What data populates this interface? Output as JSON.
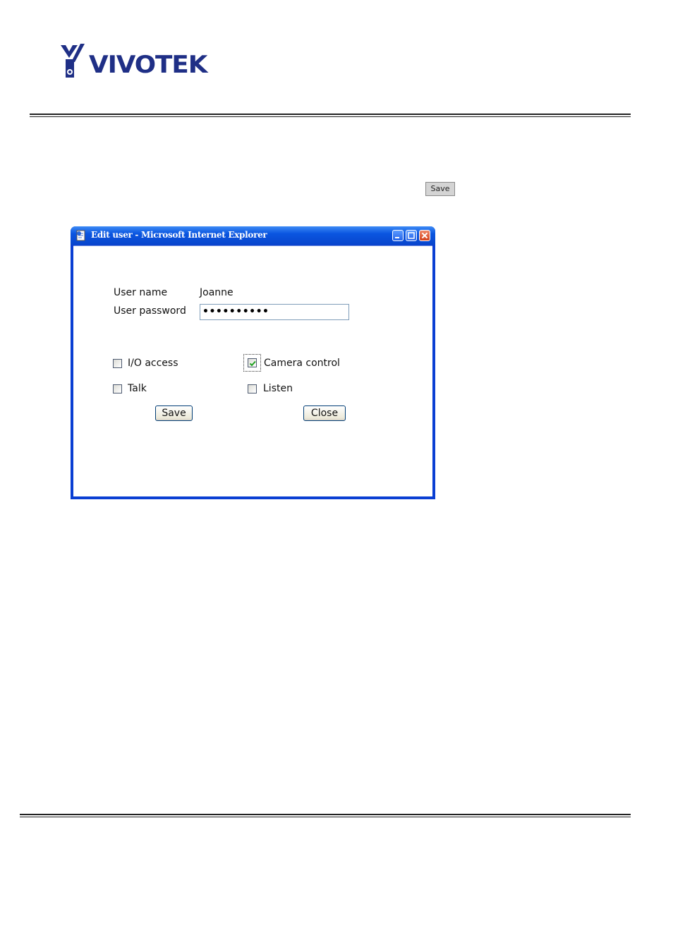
{
  "brand": {
    "logo_text": "VIVOTEK"
  },
  "page": {
    "save_button_label": "Save"
  },
  "window": {
    "title": "Edit user - Microsoft Internet Explorer"
  },
  "form": {
    "username_label": "User name",
    "username_value": "Joanne",
    "password_label": "User password",
    "password_value": "••••••••••",
    "permissions": [
      {
        "label": "I/O access",
        "checked": false
      },
      {
        "label": "Camera control",
        "checked": true
      },
      {
        "label": "Talk",
        "checked": false
      },
      {
        "label": "Listen",
        "checked": false
      }
    ],
    "save_label": "Save",
    "close_label": "Close"
  },
  "colors": {
    "brand": "#1f2f86",
    "titlebar": "#0a55e0",
    "window_frame": "#0a3fd3",
    "checkmark": "#21a121"
  }
}
